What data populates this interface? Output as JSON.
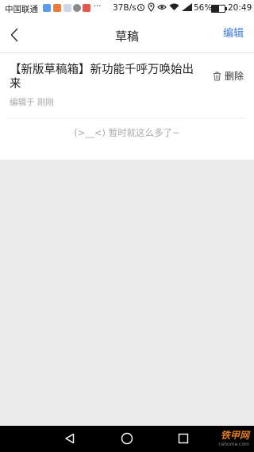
{
  "status_bar": {
    "carrier": "中国联通",
    "network_speed": "37B/s",
    "battery_level": "56%",
    "battery_fraction": 0.56,
    "time": "20:49",
    "icons": [
      "alarm-icon",
      "location-icon",
      "eye-icon",
      "wifi-icon",
      "signal-icon",
      "battery-icon"
    ]
  },
  "header": {
    "title": "草稿",
    "edit_label": "编辑"
  },
  "drafts": [
    {
      "title": "【新版草稿箱】新功能千呼万唤始出来",
      "meta": "编辑于 刚刚",
      "delete_label": "删除"
    }
  ],
  "empty_hint": "(>__<) 暂时就这么多了~",
  "watermark": {
    "main": "铁甲网",
    "sub": "cehome.com"
  },
  "colors": {
    "accent": "#3a7be0",
    "muted": "#a6a6a6",
    "watermark": "#e27b1c"
  }
}
